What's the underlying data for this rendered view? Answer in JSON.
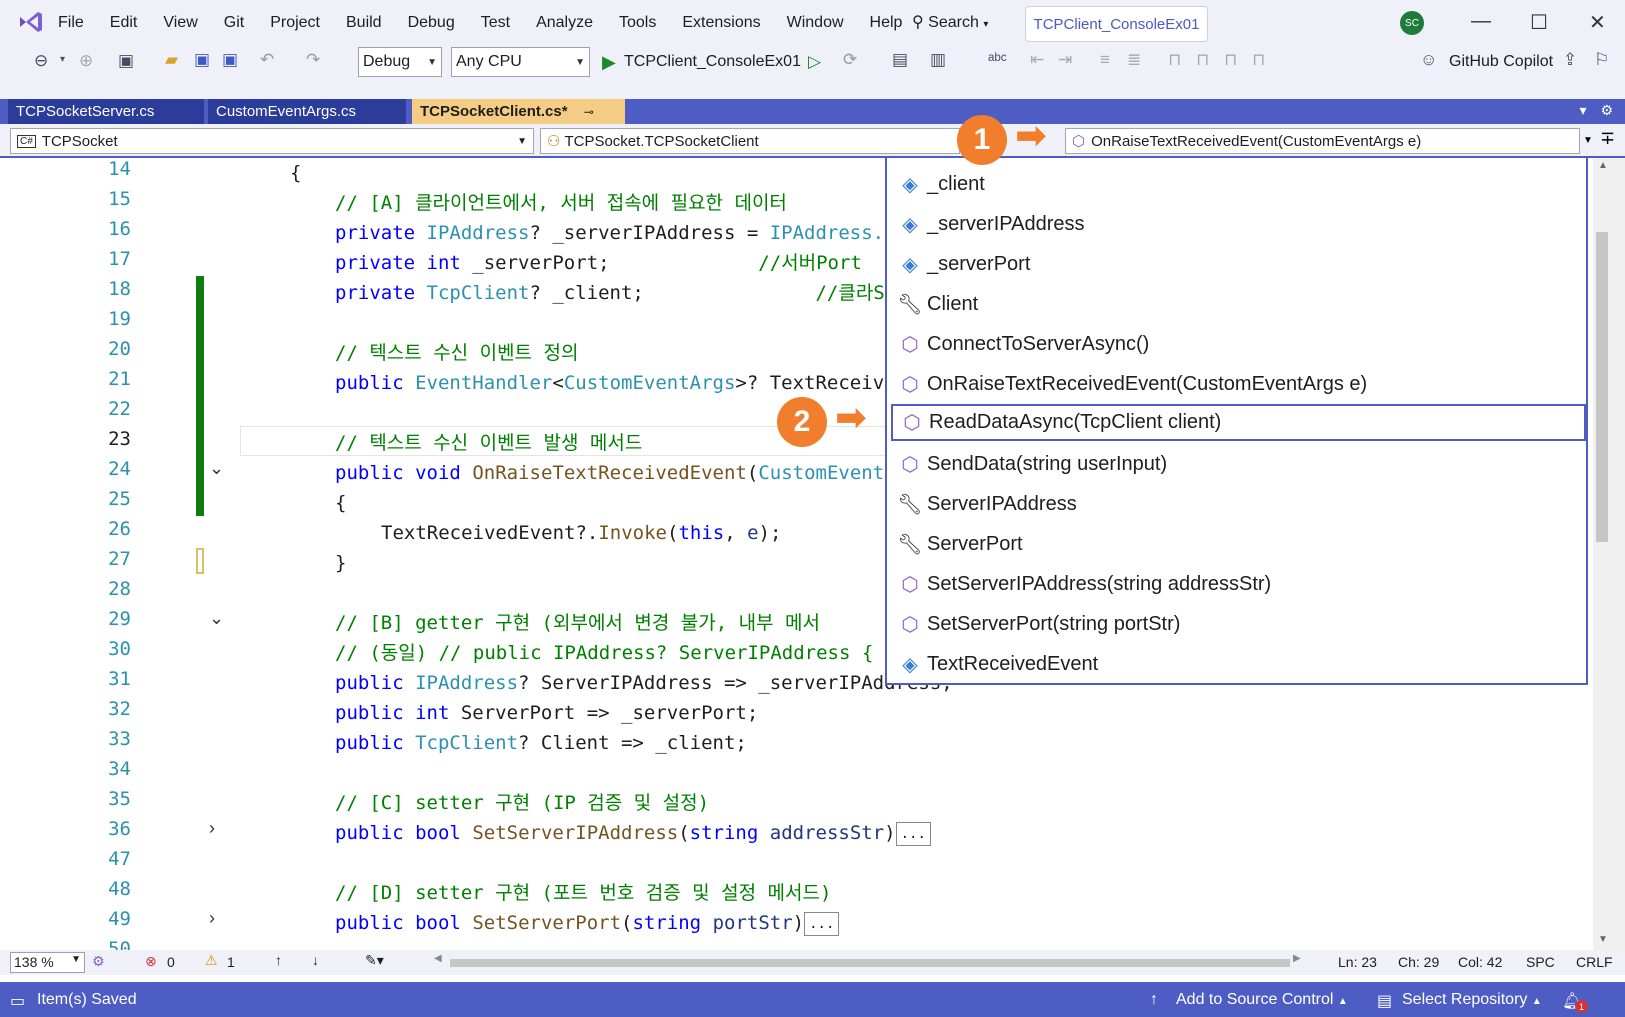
{
  "menu": [
    "File",
    "Edit",
    "View",
    "Git",
    "Project",
    "Build",
    "Debug",
    "Test",
    "Analyze",
    "Tools",
    "Extensions",
    "Window",
    "Help"
  ],
  "search_label": "Search",
  "solution_tab": "TCPClient_ConsoleEx01",
  "user_initials": "SC",
  "toolbar": {
    "config": "Debug",
    "platform": "Any CPU",
    "run_target": "TCPClient_ConsoleEx01",
    "copilot": "GitHub Copilot"
  },
  "tabs": [
    "TCPSocketServer.cs",
    "CustomEventArgs.cs",
    "TCPSocketClient.cs*"
  ],
  "nav": {
    "project": "TCPSocket",
    "type": "TCPSocket.TCPSocketClient",
    "member": "OnRaiseTextReceivedEvent(CustomEventArgs e)"
  },
  "line_numbers": [
    "14",
    "15",
    "16",
    "17",
    "18",
    "19",
    "20",
    "21",
    "22",
    "23",
    "24",
    "25",
    "26",
    "27",
    "28",
    "29",
    "30",
    "31",
    "32",
    "33",
    "34",
    "35",
    "36",
    "47",
    "48",
    "49",
    "50"
  ],
  "current_line": "23",
  "code": {
    "l14": "{",
    "l15": "// [A] 클라이언트에서, 서버 접속에 필요한 데이터",
    "l16_kw": "private",
    "l16_ty": "IPAddress",
    "l16_rest": "? _serverIPAddress = ",
    "l16_ty2": "IPAddress.",
    "l17_kw": "private",
    "l17_ty": "int",
    "l17_rest": " _serverPort;             ",
    "l17_cm": "//서버Port",
    "l18_kw": "private",
    "l18_ty": "TcpClient",
    "l18_rest": "? _client;               ",
    "l18_cm": "//클라Sock",
    "l20": "// 텍스트 수신 이벤트 정의",
    "l21_kw": "public",
    "l21_ty": "EventHandler",
    "l21_a": "<",
    "l21_ty2": "CustomEventArgs",
    "l21_rest": ">? TextReceiv",
    "l23": "// 텍스트 수신 이벤트 발생 메서드",
    "l24_kw": "public",
    "l24_kw2": "void",
    "l24_mt": "OnRaiseTextReceivedEvent",
    "l24_rest": "(",
    "l24_ty": "CustomEvent",
    "l25": "{",
    "l26_a": "TextReceivedEvent?.",
    "l26_mt": "Invoke",
    "l26_b": "(",
    "l26_kw": "this",
    "l26_c": ", ",
    "l26_pr": "e",
    "l26_d": ");",
    "l27": "}",
    "l29": "// [B] getter 구현 (외부에서 변경 불가, 내부 메서",
    "l30": "// (동일) // public IPAddress? ServerIPAddress {",
    "l31_kw": "public",
    "l31_ty": "IPAddress",
    "l31_rest": "? ServerIPAddress => _serverIPAddress;",
    "l32_kw": "public",
    "l32_ty": "int",
    "l32_rest": " ServerPort => _serverPort;",
    "l33_kw": "public",
    "l33_ty": "TcpClient",
    "l33_rest": "? Client => _client;",
    "l35": "// [C] setter 구현 (IP 검증 및 설정)",
    "l36_kw": "public",
    "l36_kw2": "bool",
    "l36_mt": "SetServerIPAddress",
    "l36_a": "(",
    "l36_kw3": "string",
    "l36_pr": " addressStr",
    "l36_b": ")",
    "l48": "// [D] setter 구현 (포트 번호 검증 및 설정 메서드)",
    "l49_kw": "public",
    "l49_kw2": "bool",
    "l49_mt": "SetServerPort",
    "l49_a": "(",
    "l49_kw3": "string",
    "l49_pr": " portStr",
    "l49_b": ")",
    "collapsed": "..."
  },
  "dropdown_items": [
    {
      "label": "_client",
      "icon": "field-private-icon"
    },
    {
      "label": "_serverIPAddress",
      "icon": "field-private-icon"
    },
    {
      "label": "_serverPort",
      "icon": "field-private-icon"
    },
    {
      "label": "Client",
      "icon": "property-icon"
    },
    {
      "label": "ConnectToServerAsync()",
      "icon": "method-icon"
    },
    {
      "label": "OnRaiseTextReceivedEvent(CustomEventArgs e)",
      "icon": "method-icon"
    },
    {
      "label": "ReadDataAsync(TcpClient client)",
      "icon": "method-private-icon"
    },
    {
      "label": "SendData(string userInput)",
      "icon": "method-icon"
    },
    {
      "label": "ServerIPAddress",
      "icon": "property-icon"
    },
    {
      "label": "ServerPort",
      "icon": "property-icon"
    },
    {
      "label": "SetServerIPAddress(string addressStr)",
      "icon": "method-icon"
    },
    {
      "label": "SetServerPort(string portStr)",
      "icon": "method-icon"
    },
    {
      "label": "TextReceivedEvent",
      "icon": "field-icon"
    }
  ],
  "selected_dropdown_item": "ReadDataAsync(TcpClient client)",
  "callouts": [
    "1",
    "2"
  ],
  "editor_status": {
    "zoom": "138 %",
    "errors": "0",
    "warnings": "1",
    "ln": "Ln: 23",
    "ch": "Ch: 29",
    "col": "Col: 42",
    "spc": "SPC",
    "crlf": "CRLF"
  },
  "statusbar": {
    "saved": "Item(s) Saved",
    "source_control": "Add to Source Control",
    "repository": "Select Repository",
    "notifications": "1"
  },
  "colors": {
    "accent": "#4d5dc4",
    "callout": "#f07e2c",
    "active_tab": "#f5cc84",
    "change_bar": "#107c10"
  }
}
